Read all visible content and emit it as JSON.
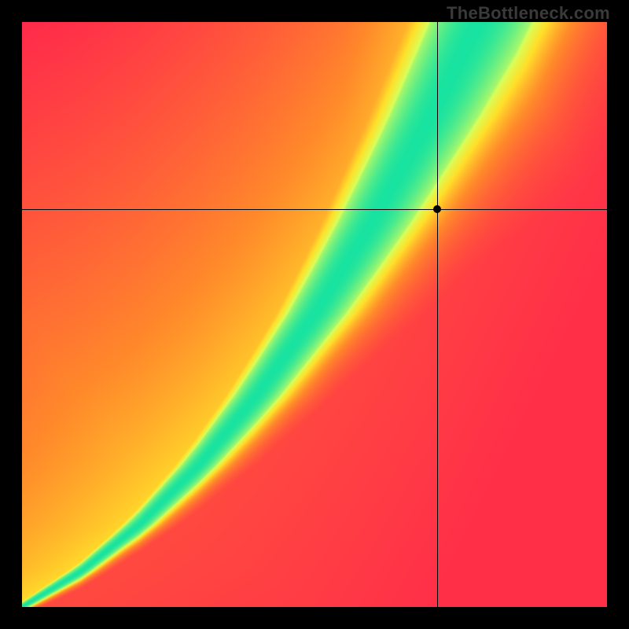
{
  "watermark": "TheBottleneck.com",
  "chart_data": {
    "type": "heatmap",
    "title": "",
    "xlabel": "",
    "ylabel": "",
    "x_range": [
      0,
      1
    ],
    "y_range": [
      0,
      1
    ],
    "crosshair": {
      "x": 0.71,
      "y": 0.68
    },
    "marker": {
      "x": 0.71,
      "y": 0.68
    },
    "grid": false,
    "legend": false,
    "colorscale": [
      {
        "stop": 0.0,
        "color": "#ff2a4a"
      },
      {
        "stop": 0.35,
        "color": "#ff8a2a"
      },
      {
        "stop": 0.6,
        "color": "#ffe02a"
      },
      {
        "stop": 0.8,
        "color": "#d8ff5a"
      },
      {
        "stop": 1.0,
        "color": "#18e3a0"
      }
    ],
    "ridge": {
      "points": [
        {
          "x": 0.0,
          "y": 0.0
        },
        {
          "x": 0.1,
          "y": 0.06
        },
        {
          "x": 0.2,
          "y": 0.14
        },
        {
          "x": 0.3,
          "y": 0.24
        },
        {
          "x": 0.4,
          "y": 0.36
        },
        {
          "x": 0.5,
          "y": 0.5
        },
        {
          "x": 0.6,
          "y": 0.66
        },
        {
          "x": 0.7,
          "y": 0.84
        },
        {
          "x": 0.78,
          "y": 1.0
        }
      ],
      "width_profile": [
        {
          "x": 0.0,
          "w": 0.008
        },
        {
          "x": 0.2,
          "w": 0.02
        },
        {
          "x": 0.4,
          "w": 0.04
        },
        {
          "x": 0.6,
          "w": 0.065
        },
        {
          "x": 0.8,
          "w": 0.1
        },
        {
          "x": 1.0,
          "w": 0.14
        }
      ]
    },
    "background_gradient": {
      "upper_left": "#ff2a4a",
      "upper_right": "#ffe02a",
      "lower_left": "#ff2a4a",
      "lower_right": "#ff2a4a",
      "mid_top": "#ffe02a"
    }
  }
}
